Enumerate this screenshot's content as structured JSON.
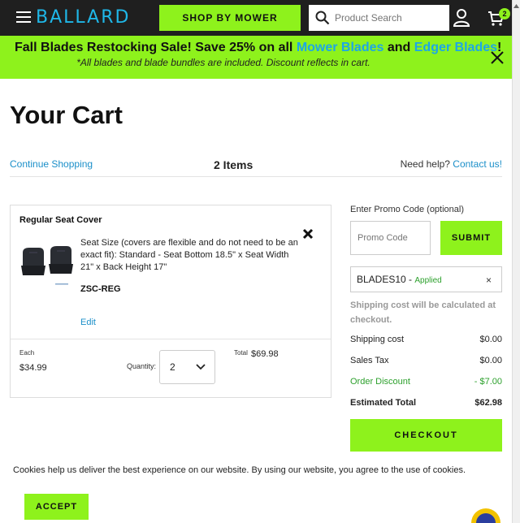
{
  "header": {
    "logo": "BALLARD",
    "shop_by_mower": "SHOP BY MOWER",
    "search_placeholder": "Product Search",
    "cart_count": "2"
  },
  "banner": {
    "title_part1": "Fall Blades Restocking Sale! Save 25% on all ",
    "title_link1": "Mower Blades",
    "title_part2": " and ",
    "title_link2": "Edger Blades",
    "title_part3": "!",
    "subtitle": "*All blades and blade bundles are included. Discount reflects in cart."
  },
  "page": {
    "title": "Your Cart",
    "continue_shopping": "Continue Shopping",
    "items_count": "2 Items",
    "help_text": "Need help? ",
    "help_link": "Contact us!"
  },
  "cart_items": [
    {
      "name": "Regular Seat Cover",
      "description": "Seat Size (covers are flexible and do not need to be an exact fit): Standard - Seat Bottom 18.5\" x Seat Width 21\" x Back Height 17\"",
      "sku": "ZSC-REG",
      "edit_label": "Edit",
      "each_label": "Each",
      "each_price": "$34.99",
      "quantity_label": "Quantity:",
      "quantity": "2",
      "total_label": "Total",
      "total_price": "$69.98"
    }
  ],
  "summary": {
    "promo_label": "Enter Promo Code (optional)",
    "promo_placeholder": "Promo Code",
    "submit_label": "SUBMIT",
    "applied_code": "BLADES10",
    "applied_status": "Applied",
    "applied_remove": "×",
    "shipping_note": "Shipping cost will be calculated at checkout.",
    "rows": [
      {
        "label": "Shipping cost",
        "value": "$0.00"
      },
      {
        "label": "Sales Tax",
        "value": "$0.00"
      },
      {
        "label": "Order Discount",
        "value": "- $7.00"
      },
      {
        "label": "Estimated Total",
        "value": "$62.98"
      }
    ],
    "checkout_label": "CHECKOUT"
  },
  "cookie": {
    "text": "Cookies help us deliver the best experience on our website. By using our website, you agree to the use of cookies.",
    "accept_label": "ACCEPT"
  },
  "colors": {
    "accent_green": "#8ef21c",
    "link_blue": "#1b8fc9",
    "nav_dark": "#1f1f1f",
    "discount_green": "#2ca02c"
  }
}
